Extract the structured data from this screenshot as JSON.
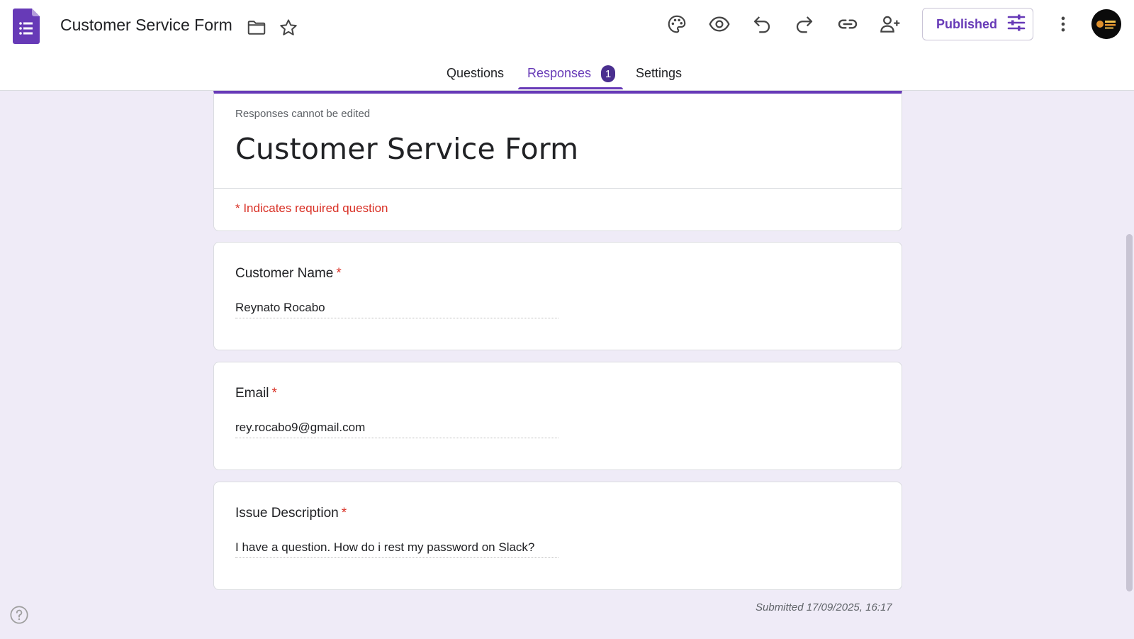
{
  "header": {
    "doc_title": "Customer Service Form",
    "publish_label": "Published",
    "icons": [
      "folder-icon",
      "star-icon",
      "palette-icon",
      "preview-icon",
      "undo-icon",
      "redo-icon",
      "link-icon",
      "add-collaborator-icon",
      "tune-icon",
      "more-vert-icon"
    ]
  },
  "tabs": [
    {
      "label": "Questions",
      "active": false
    },
    {
      "label": "Responses",
      "active": true,
      "badge": "1"
    },
    {
      "label": "Settings",
      "active": false
    }
  ],
  "form": {
    "note": "Responses cannot be edited",
    "title": "Customer Service Form",
    "required_note": "* Indicates required question",
    "questions": [
      {
        "label": "Customer Name",
        "required_mark": "*",
        "answer": "Reynato Rocabo"
      },
      {
        "label": "Email",
        "required_mark": "*",
        "answer": "rey.rocabo9@gmail.com"
      },
      {
        "label": "Issue Description",
        "required_mark": "*",
        "answer": "I have a question. How do i rest my password on Slack?"
      }
    ],
    "submitted": "Submitted 17/09/2025, 16:17"
  },
  "colors": {
    "accent": "#673ab7",
    "background": "#efebf7",
    "required": "#d93025"
  }
}
